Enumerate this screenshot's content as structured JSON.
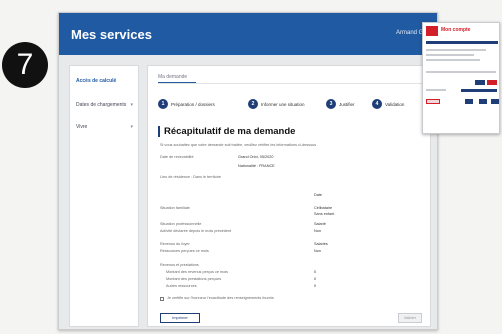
{
  "app": {
    "title": "Mes services",
    "user": "Armand G."
  },
  "step_badge": "7",
  "sidebar": {
    "items": [
      {
        "label": "Accès de calculé",
        "active": true
      },
      {
        "label": "Dates de chargements",
        "active": false
      },
      {
        "label": "Vivre",
        "active": false
      }
    ]
  },
  "tab": {
    "label": "Ma demande"
  },
  "stepper": [
    {
      "num": "1",
      "label": "Préparation / dossiers"
    },
    {
      "num": "2",
      "label": "Informer une situation"
    },
    {
      "num": "3",
      "label": "Justifier"
    },
    {
      "num": "4",
      "label": "Validation"
    }
  ],
  "page_title": "Récapitulatif de ma demande",
  "summary": {
    "intro": "Si vous souhaitez que votre demande soit traitée, veuillez vérifier les informations ci-dessous",
    "lines": [
      {
        "label": "Date de recevabilité",
        "value": "Grand Oriol, 05/2020"
      },
      {
        "label": "",
        "value": "Nationalité : FRANCE"
      },
      {
        "label": "Lieu de résidence : Dans le territoire",
        "value": ""
      }
    ],
    "col_header": "Date",
    "rows": [
      {
        "label": "Situation familiale",
        "value": "Célibataire"
      },
      {
        "label": "",
        "value": "Sans enfant"
      },
      {
        "label": "Situation professionnelle",
        "value": "Salarié"
      },
      {
        "label": "Activité déclarée depuis le mois précédent",
        "value": "Non"
      },
      {
        "label": "Revenus du foyer",
        "value": "Salariés"
      },
      {
        "label": "Ressources perçues ce mois",
        "value": "Non"
      }
    ],
    "sub_title": "Revenus et prestations",
    "sub_rows": [
      {
        "label": "Montant des revenus perçus ce mois",
        "value": "0"
      },
      {
        "label": "Montant des prestations perçues",
        "value": "0"
      },
      {
        "label": "Autres ressources",
        "value": "0"
      }
    ],
    "attestation": "Je certifie sur l'honneur l'exactitude des renseignements fournis"
  },
  "buttons": {
    "print": "Imprimer",
    "send": "Valider"
  },
  "mini": {
    "brand": "Mon compte"
  }
}
